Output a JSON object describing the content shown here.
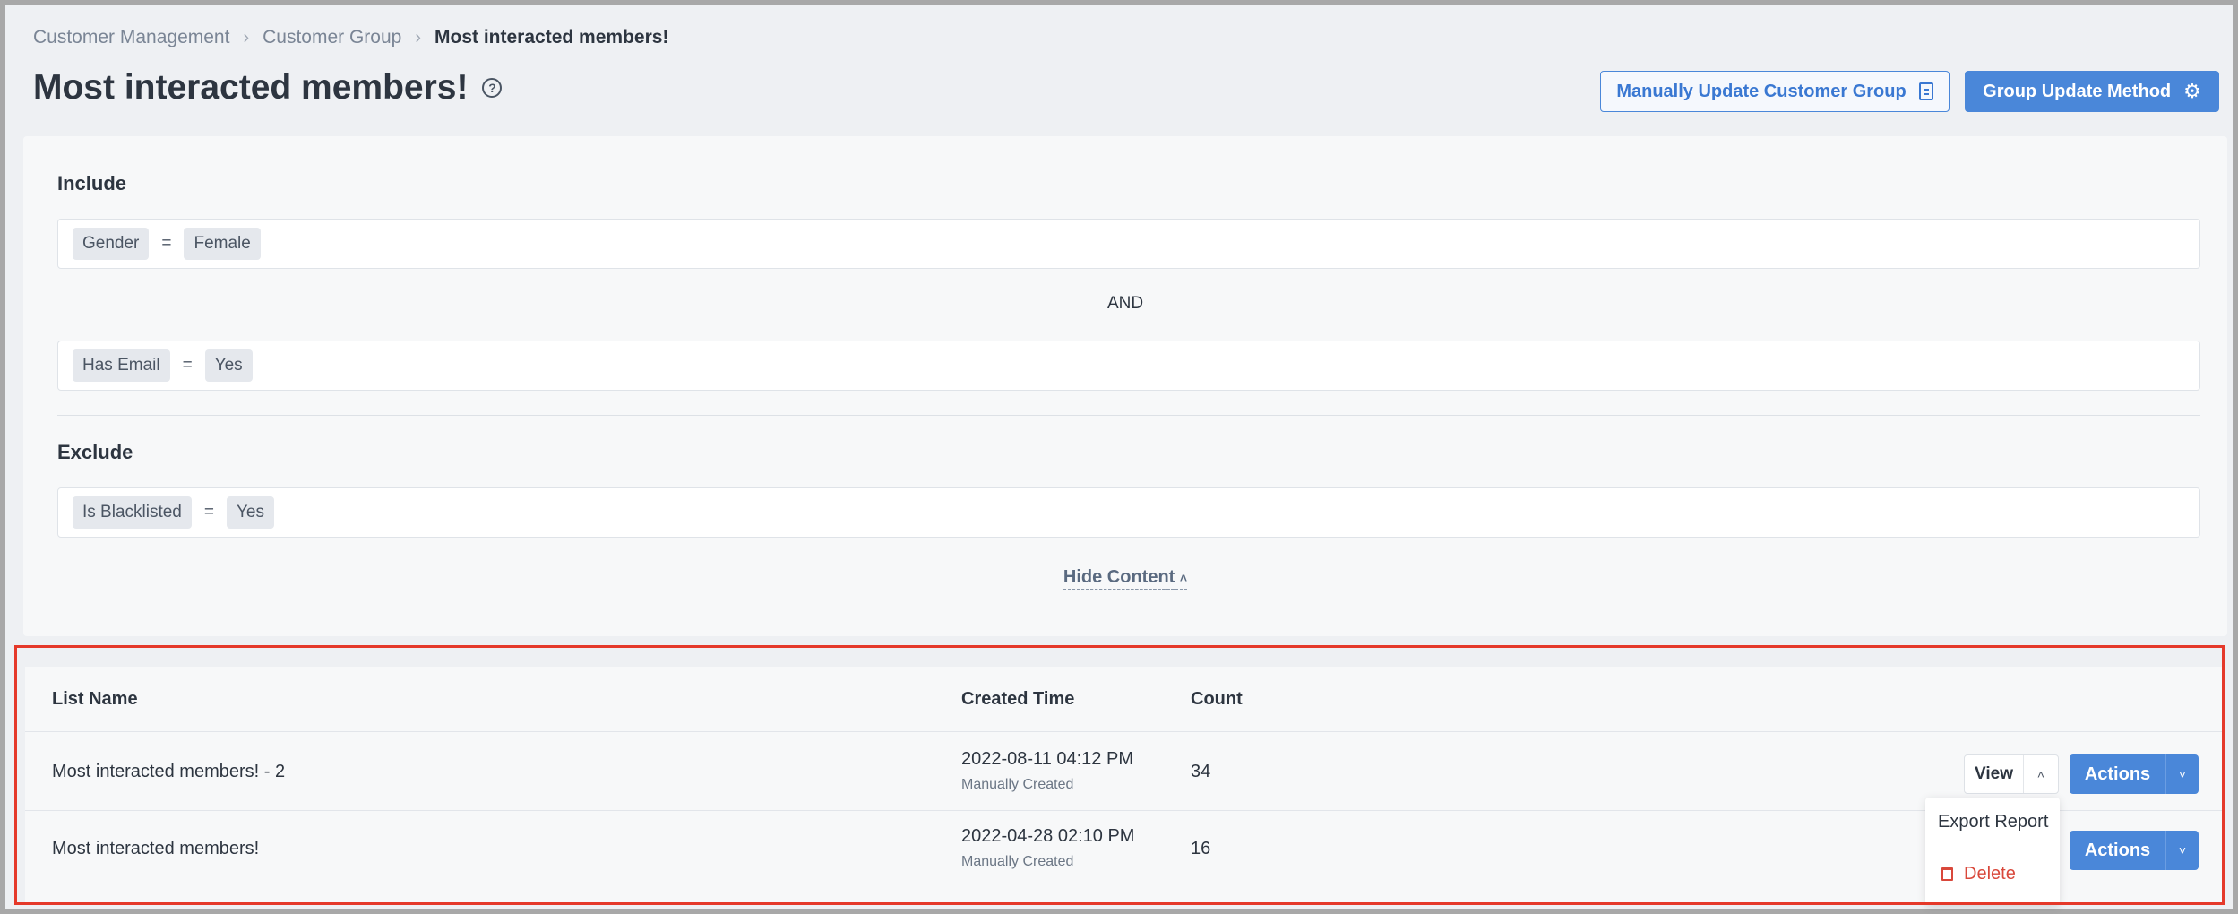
{
  "breadcrumb": {
    "items": [
      "Customer Management",
      "Customer Group"
    ],
    "current": "Most interacted members!"
  },
  "page": {
    "title": "Most interacted members!",
    "help_icon": "question-circle-icon"
  },
  "header_actions": {
    "manual_update_label": "Manually Update Customer Group",
    "manual_update_icon": "clipboard-icon",
    "update_method_label": "Group Update Method",
    "update_method_icon": "gear-icon"
  },
  "criteria": {
    "include_title": "Include",
    "include_rules": [
      {
        "field": "Gender",
        "operator": "=",
        "value": "Female"
      },
      {
        "field": "Has Email",
        "operator": "=",
        "value": "Yes"
      }
    ],
    "connector": "AND",
    "exclude_title": "Exclude",
    "exclude_rules": [
      {
        "field": "Is Blacklisted",
        "operator": "=",
        "value": "Yes"
      }
    ],
    "toggle_label": "Hide Content",
    "toggle_icon": "chevron-up-icon"
  },
  "table": {
    "columns": [
      "List Name",
      "Created Time",
      "Count"
    ],
    "rows": [
      {
        "name": "Most interacted members! - 2",
        "created": "2022-08-11 04:12 PM",
        "created_sub": "Manually Created",
        "count": "34"
      },
      {
        "name": "Most interacted members!",
        "created": "2022-04-28 02:10 PM",
        "created_sub": "Manually Created",
        "count": "16"
      }
    ],
    "view_label": "View",
    "actions_label": "Actions"
  },
  "dropdown": {
    "items": [
      {
        "label": "Export Report"
      },
      {
        "label": "Delete",
        "icon": "trash-icon"
      }
    ]
  },
  "colors": {
    "primary": "#4a87d9",
    "danger": "#d9483b",
    "highlight": "#e5392a"
  }
}
